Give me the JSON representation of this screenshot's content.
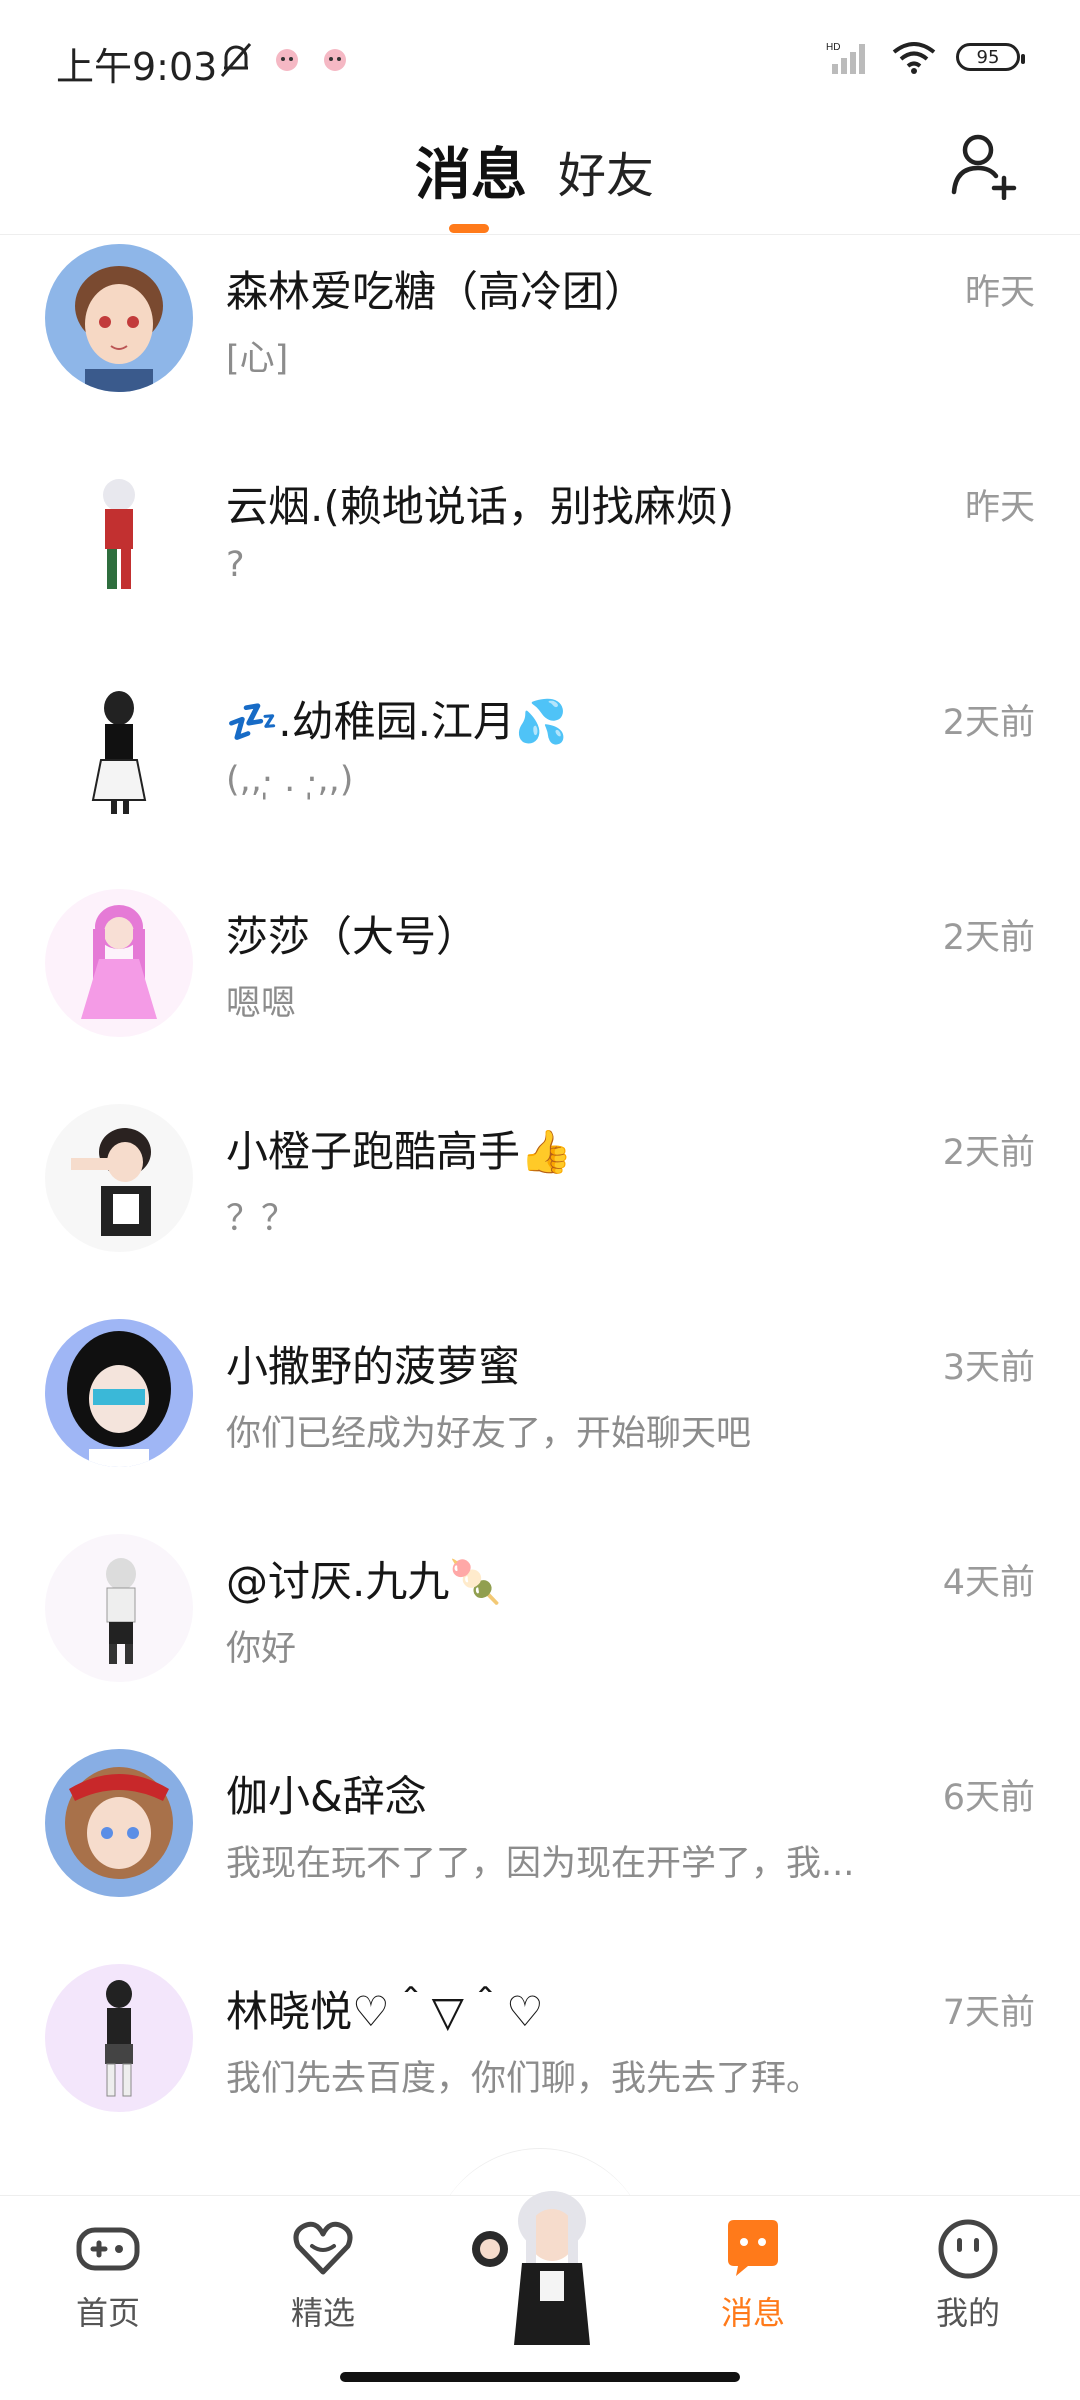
{
  "status_bar": {
    "time": "上午9:03",
    "battery": "95",
    "network_label": "HD"
  },
  "header": {
    "tab_messages": "消息",
    "tab_friends": "好友",
    "accent_color": "#ff7a1a"
  },
  "messages": [
    {
      "name": "森林爱吃糖（高冷团）",
      "preview": "[心]",
      "time": "昨天"
    },
    {
      "name": "云烟.(赖地说话，别找麻烦)",
      "preview": "?",
      "time": "昨天"
    },
    {
      "name": "💤.幼稚园.江月💦",
      "preview": "(,,·̩̩̩ . ·̩̩̩,,)",
      "time": "2天前"
    },
    {
      "name": "莎莎（大号）",
      "preview": "嗯嗯",
      "time": "2天前"
    },
    {
      "name": "小橙子跑酷高手👍",
      "preview": "？？",
      "time": "2天前"
    },
    {
      "name": "小撒野的菠萝蜜",
      "preview": "你们已经成为好友了，开始聊天吧",
      "time": "3天前"
    },
    {
      "name": "@讨厌.九九🍡",
      "preview": "你好",
      "time": "4天前"
    },
    {
      "name": "伽小&辞念",
      "preview": "我现在玩不了了，因为现在开学了，我...",
      "time": "6天前"
    },
    {
      "name": "林晓悦♡＾▽＾♡",
      "preview": "我们先去百度，你们聊，我先去了拜。",
      "time": "7天前"
    }
  ],
  "bottom_nav": {
    "home": "首页",
    "featured": "精选",
    "messages": "消息",
    "mine": "我的"
  }
}
